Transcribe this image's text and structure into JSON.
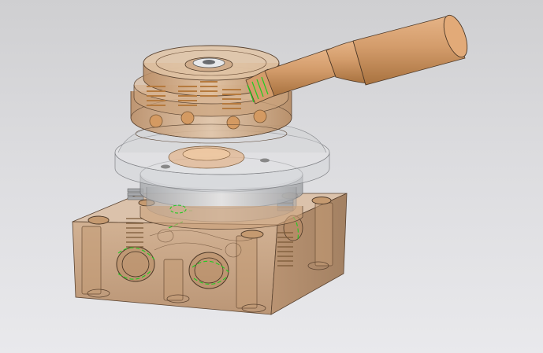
{
  "scene": {
    "subject": "rotary-hand-lever-valve-assembly",
    "render_mode": "translucent-shaded",
    "colors": {
      "background_top": "#cfcfd1",
      "background_bottom": "#e9e9ec",
      "body": "#c9a07a",
      "body_dark": "#a8825f",
      "handle": "#d39c6b",
      "cap": "#d7b392",
      "steel": "#c8c9cb",
      "steel_dark": "#9d9fa2",
      "highlight_edges": "#22cc22",
      "outline": "#3a2a1c"
    }
  }
}
